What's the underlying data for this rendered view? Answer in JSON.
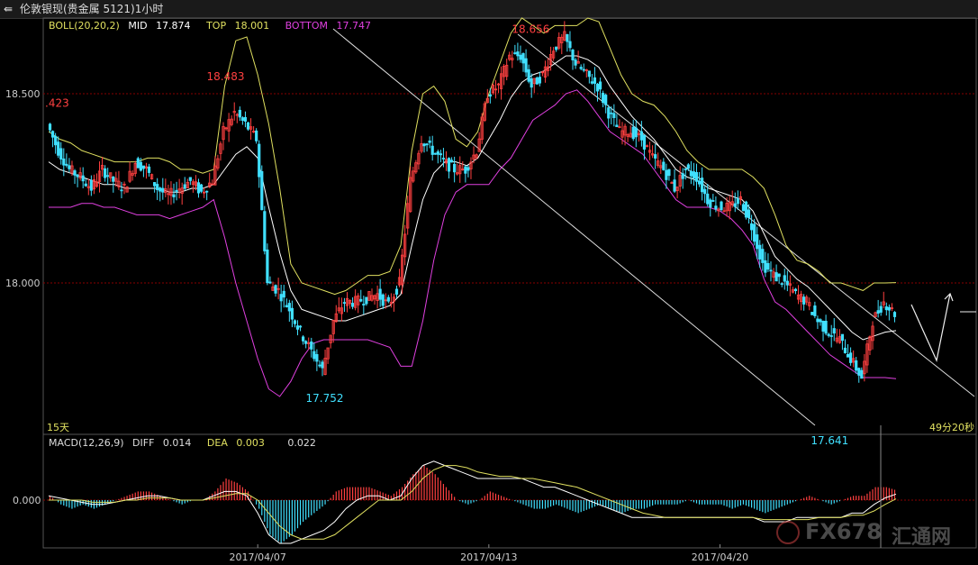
{
  "window": {
    "back_icon": "back-arrow-icon",
    "title": "伦敦银现(贵金属 5121)1小时"
  },
  "colors": {
    "up": "#ff4040",
    "down": "#40e0ff",
    "mid": "#ffffff",
    "top": "#e0e060",
    "bottom": "#e040e0",
    "grid": "#880000",
    "diff": "#ffffff",
    "dea": "#e0e060"
  },
  "boll": {
    "name": "BOLL(20,20,2)",
    "mid_label": "MID",
    "mid": "17.874",
    "top_label": "TOP",
    "top": "18.001",
    "bottom_label": "BOTTOM",
    "bottom": "17.747"
  },
  "macd": {
    "name": "MACD(12,26,9)",
    "diff_label": "DIFF",
    "diff": "0.014",
    "dea_label": "DEA",
    "dea": "0.003",
    "macd": "0.022"
  },
  "period_label": "15天",
  "countdown": "49分20秒",
  "watermark": {
    "logo_icon": "fx678-logo-icon",
    "brand": "FX678",
    "cn": "汇通网"
  },
  "chart_data": {
    "type": "candlestick",
    "price_axis": {
      "ticks": [
        18.5,
        18.0
      ],
      "tick_labels": [
        "18.500",
        "18.000"
      ],
      "range": [
        17.62,
        18.72
      ],
      "grid": true
    },
    "macd_axis": {
      "ticks": [
        0
      ],
      "tick_labels": [
        "0.000"
      ],
      "range": [
        -0.12,
        0.1
      ]
    },
    "x_axis": {
      "labels": [
        "2017/04/07",
        "2017/04/13",
        "2017/04/20"
      ]
    },
    "annotations": [
      {
        "text": ".423",
        "value": 18.423
      },
      {
        "text": "18.483",
        "value": 18.483
      },
      {
        "text": "17.752",
        "value": 17.752
      },
      {
        "text": "18.656",
        "value": 18.656
      },
      {
        "text": "17.641",
        "value": 17.641
      }
    ],
    "close_path": [
      18.42,
      18.35,
      18.3,
      18.28,
      18.25,
      18.3,
      18.27,
      18.25,
      18.32,
      18.3,
      18.25,
      18.23,
      18.25,
      18.27,
      18.24,
      18.27,
      18.4,
      18.45,
      18.42,
      18.38,
      18.0,
      17.98,
      17.93,
      17.87,
      17.82,
      17.77,
      17.9,
      17.95,
      17.95,
      17.96,
      17.97,
      17.94,
      18.0,
      18.27,
      18.38,
      18.35,
      18.32,
      18.3,
      18.3,
      18.35,
      18.5,
      18.52,
      18.6,
      18.6,
      18.52,
      18.55,
      18.62,
      18.65,
      18.58,
      18.55,
      18.52,
      18.45,
      18.4,
      18.4,
      18.38,
      18.33,
      18.3,
      18.25,
      18.3,
      18.28,
      18.22,
      18.2,
      18.2,
      18.22,
      18.15,
      18.05,
      18.02,
      18.0,
      17.97,
      17.95,
      17.9,
      17.87,
      17.85,
      17.8,
      17.75,
      17.9,
      17.95,
      17.92
    ],
    "mid_path": [
      18.32,
      18.3,
      18.29,
      18.28,
      18.27,
      18.26,
      18.26,
      18.25,
      18.25,
      18.25,
      18.25,
      18.24,
      18.24,
      18.25,
      18.25,
      18.26,
      18.3,
      18.34,
      18.36,
      18.33,
      18.2,
      18.08,
      17.98,
      17.93,
      17.92,
      17.91,
      17.9,
      17.9,
      17.91,
      17.92,
      17.93,
      17.94,
      17.97,
      18.1,
      18.22,
      18.29,
      18.32,
      18.32,
      18.31,
      18.33,
      18.38,
      18.43,
      18.49,
      18.53,
      18.55,
      18.56,
      18.58,
      18.6,
      18.6,
      18.59,
      18.57,
      18.52,
      18.48,
      18.44,
      18.41,
      18.38,
      18.34,
      18.3,
      18.28,
      18.27,
      18.25,
      18.24,
      18.23,
      18.22,
      18.19,
      18.13,
      18.07,
      18.04,
      18.01,
      17.99,
      17.96,
      17.93,
      17.9,
      17.87,
      17.85,
      17.86,
      17.87,
      17.874
    ],
    "top_path": [
      18.4,
      18.38,
      18.37,
      18.35,
      18.34,
      18.33,
      18.32,
      18.32,
      18.32,
      18.33,
      18.33,
      18.32,
      18.3,
      18.3,
      18.29,
      18.3,
      18.52,
      18.64,
      18.65,
      18.55,
      18.42,
      18.25,
      18.05,
      18.0,
      17.99,
      17.98,
      17.97,
      17.98,
      18.0,
      18.02,
      18.02,
      18.03,
      18.1,
      18.35,
      18.5,
      18.52,
      18.48,
      18.38,
      18.36,
      18.4,
      18.5,
      18.58,
      18.66,
      18.7,
      18.68,
      18.66,
      18.68,
      18.68,
      18.68,
      18.7,
      18.69,
      18.62,
      18.55,
      18.5,
      18.48,
      18.47,
      18.44,
      18.4,
      18.35,
      18.32,
      18.3,
      18.3,
      18.3,
      18.3,
      18.28,
      18.25,
      18.18,
      18.1,
      18.06,
      18.05,
      18.03,
      18.0,
      18.0,
      17.99,
      17.98,
      18.0,
      18.0,
      18.001
    ],
    "bottom_path": [
      18.2,
      18.2,
      18.2,
      18.21,
      18.21,
      18.2,
      18.2,
      18.19,
      18.18,
      18.18,
      18.18,
      18.17,
      18.18,
      18.19,
      18.2,
      18.22,
      18.12,
      18.0,
      17.9,
      17.8,
      17.72,
      17.7,
      17.74,
      17.8,
      17.84,
      17.85,
      17.85,
      17.85,
      17.85,
      17.85,
      17.84,
      17.83,
      17.78,
      17.78,
      17.9,
      18.06,
      18.18,
      18.24,
      18.26,
      18.26,
      18.26,
      18.3,
      18.33,
      18.38,
      18.43,
      18.45,
      18.47,
      18.5,
      18.51,
      18.48,
      18.44,
      18.4,
      18.38,
      18.36,
      18.34,
      18.3,
      18.26,
      18.22,
      18.2,
      18.2,
      18.2,
      18.19,
      18.17,
      18.14,
      18.1,
      18.01,
      17.95,
      17.93,
      17.9,
      17.87,
      17.84,
      17.81,
      17.79,
      17.77,
      17.75,
      17.75,
      17.75,
      17.747
    ],
    "macd_hist": [
      0.01,
      -0.01,
      -0.02,
      -0.01,
      -0.02,
      -0.01,
      0.0,
      0.01,
      0.02,
      0.02,
      0.01,
      0.0,
      -0.01,
      0.0,
      0.0,
      0.02,
      0.05,
      0.04,
      0.02,
      -0.02,
      -0.08,
      -0.1,
      -0.08,
      -0.05,
      -0.03,
      -0.01,
      0.02,
      0.03,
      0.03,
      0.03,
      0.02,
      0.01,
      0.03,
      0.06,
      0.08,
      0.06,
      0.03,
      0.0,
      -0.01,
      0.0,
      0.02,
      0.01,
      0.0,
      -0.01,
      -0.02,
      -0.02,
      -0.01,
      -0.02,
      -0.03,
      -0.02,
      -0.01,
      -0.02,
      -0.03,
      -0.02,
      -0.02,
      -0.01,
      -0.01,
      -0.01,
      0.0,
      -0.01,
      -0.01,
      -0.01,
      -0.02,
      -0.01,
      -0.02,
      -0.03,
      -0.02,
      -0.01,
      0.0,
      0.01,
      0.0,
      -0.01,
      0.0,
      0.01,
      0.01,
      0.03,
      0.03,
      0.022
    ],
    "diff_path": [
      0.01,
      0.005,
      0.0,
      -0.005,
      -0.01,
      -0.01,
      -0.005,
      0.0,
      0.005,
      0.01,
      0.01,
      0.005,
      0.0,
      0.0,
      0.0,
      0.01,
      0.02,
      0.02,
      0.01,
      -0.03,
      -0.08,
      -0.1,
      -0.1,
      -0.09,
      -0.08,
      -0.07,
      -0.05,
      -0.02,
      0.0,
      0.01,
      0.01,
      0.0,
      0.01,
      0.05,
      0.08,
      0.09,
      0.08,
      0.07,
      0.06,
      0.05,
      0.05,
      0.05,
      0.05,
      0.05,
      0.04,
      0.03,
      0.03,
      0.02,
      0.01,
      0.0,
      -0.01,
      -0.02,
      -0.03,
      -0.04,
      -0.04,
      -0.04,
      -0.04,
      -0.04,
      -0.04,
      -0.04,
      -0.04,
      -0.04,
      -0.04,
      -0.04,
      -0.04,
      -0.05,
      -0.05,
      -0.05,
      -0.04,
      -0.04,
      -0.04,
      -0.04,
      -0.04,
      -0.03,
      -0.03,
      -0.01,
      0.005,
      0.014
    ],
    "dea_path": [
      0.0,
      0.0,
      0.0,
      0.0,
      -0.005,
      -0.005,
      -0.005,
      0.0,
      0.0,
      0.005,
      0.005,
      0.005,
      0.0,
      0.0,
      0.0,
      0.005,
      0.01,
      0.015,
      0.015,
      0.0,
      -0.03,
      -0.06,
      -0.08,
      -0.09,
      -0.09,
      -0.09,
      -0.08,
      -0.06,
      -0.04,
      -0.02,
      0.0,
      0.0,
      0.0,
      0.02,
      0.05,
      0.07,
      0.08,
      0.08,
      0.075,
      0.065,
      0.06,
      0.055,
      0.055,
      0.05,
      0.05,
      0.045,
      0.04,
      0.035,
      0.03,
      0.02,
      0.01,
      0.0,
      -0.01,
      -0.02,
      -0.03,
      -0.035,
      -0.04,
      -0.04,
      -0.04,
      -0.04,
      -0.04,
      -0.04,
      -0.04,
      -0.04,
      -0.04,
      -0.045,
      -0.045,
      -0.045,
      -0.045,
      -0.045,
      -0.04,
      -0.04,
      -0.04,
      -0.035,
      -0.035,
      -0.025,
      -0.01,
      0.003
    ]
  }
}
